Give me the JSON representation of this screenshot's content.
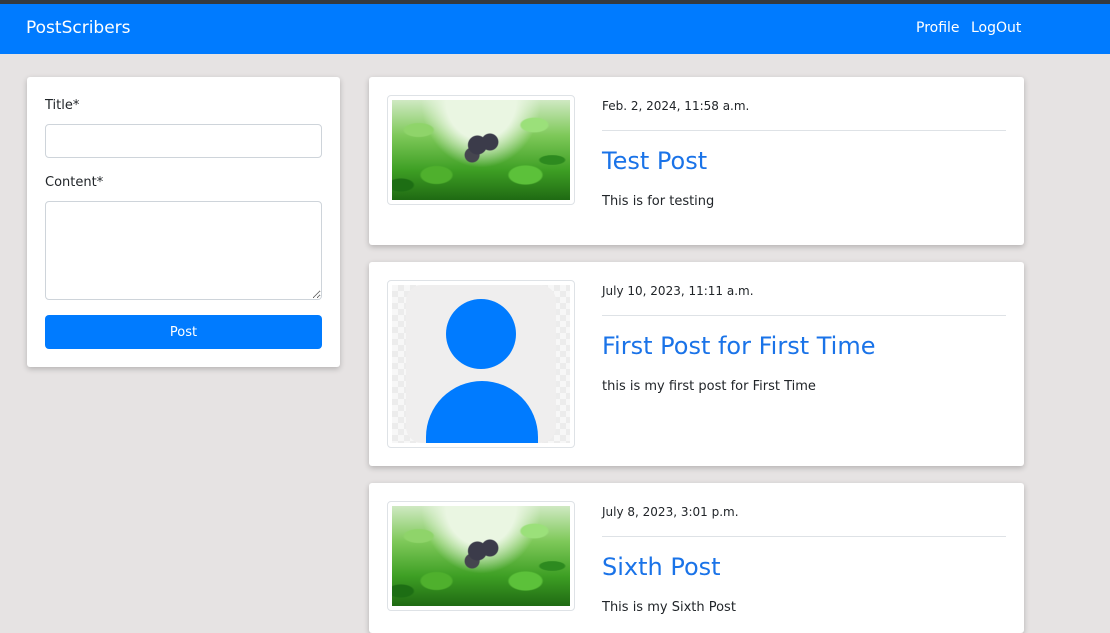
{
  "navbar": {
    "brand": "PostScribers",
    "links": [
      "Profile",
      "LogOut"
    ],
    "color": "#007bff"
  },
  "form": {
    "title_label": "Title*",
    "title_value": "",
    "content_label": "Content*",
    "content_value": "",
    "submit_label": "Post"
  },
  "posts": [
    {
      "date": "Feb. 2, 2024, 11:58 a.m.",
      "title": "Test Post",
      "body": "This is for testing",
      "image": "clover-photo"
    },
    {
      "date": "July 10, 2023, 11:11 a.m.",
      "title": "First Post for First Time",
      "body": "this is my first post for First Time",
      "image": "default-avatar"
    },
    {
      "date": "July 8, 2023, 3:01 p.m.",
      "title": "Sixth Post",
      "body": "This is my Sixth Post",
      "image": "clover-photo"
    }
  ]
}
